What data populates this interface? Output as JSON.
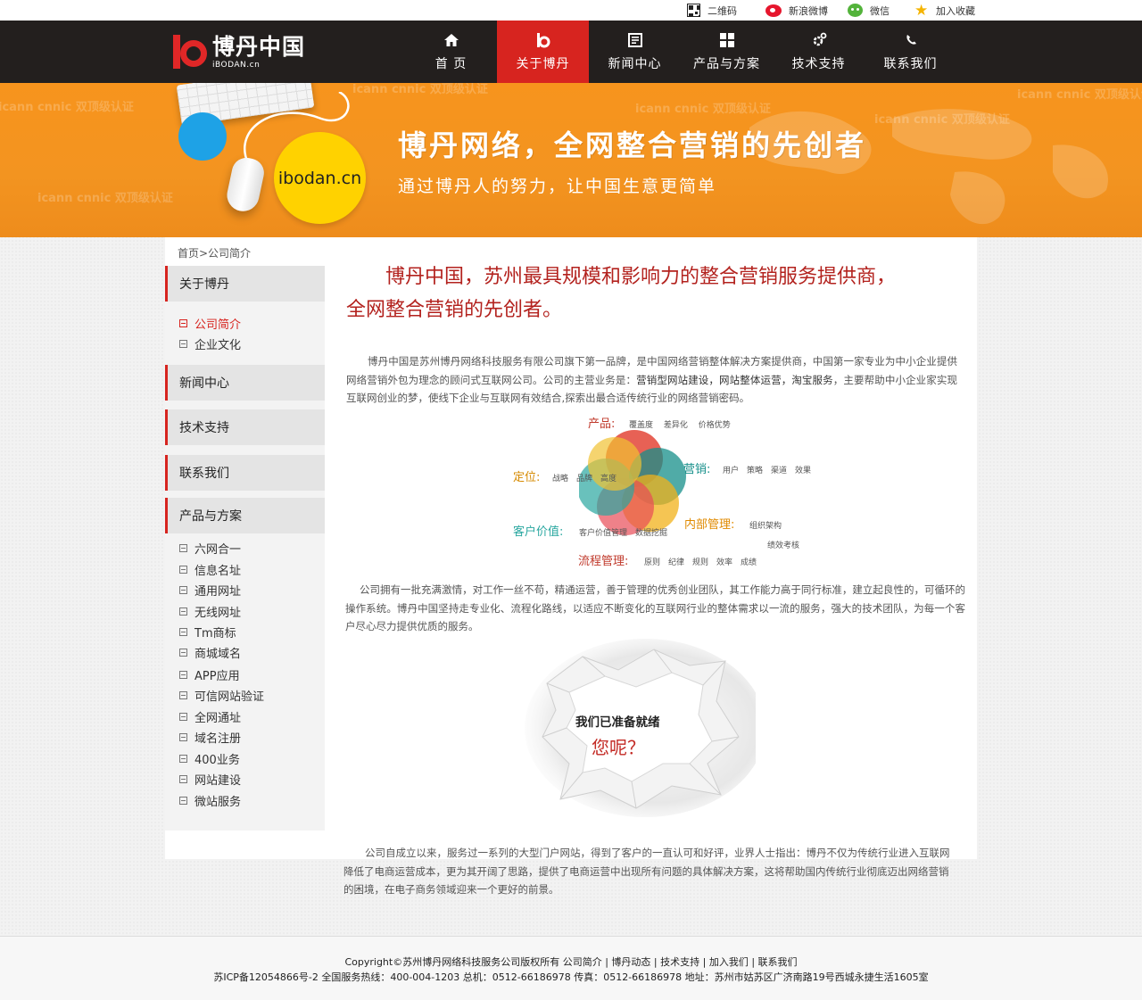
{
  "topbar": {
    "items": [
      {
        "label": "二维码",
        "icon": "qr-code-icon"
      },
      {
        "label": "新浪微博",
        "icon": "weibo-icon"
      },
      {
        "label": "微信",
        "icon": "wechat-icon"
      },
      {
        "label": "加入收藏",
        "icon": "star-icon"
      }
    ]
  },
  "header": {
    "logo_name": "博丹中国",
    "logo_sub": "iBODAN.cn",
    "nav": [
      {
        "label": "首 页",
        "icon": "home-icon"
      },
      {
        "label": "关于博丹",
        "icon": "logo-b-icon",
        "active": true
      },
      {
        "label": "新闻中心",
        "icon": "news-icon"
      },
      {
        "label": "产品与方案",
        "icon": "grid-icon"
      },
      {
        "label": "技术支持",
        "icon": "gear-icon"
      },
      {
        "label": "联系我们",
        "icon": "phone-icon"
      }
    ],
    "accent_color": "#d7241f"
  },
  "banner": {
    "title": "博丹网络，全网整合营销的先创者",
    "subtitle": "通过博丹人的努力，让中国生意更简单",
    "domain_badge": "ibodan.cn",
    "watermarks": [
      "icann cnnic 双顶级认证",
      "icann cnnic 双顶级认证",
      "icann cnnic 双顶级认证",
      "icann cnnic 双顶级认证",
      "icann cnnic 双顶级认证",
      "icann cnnic 双顶级认证"
    ],
    "color": "#f39420"
  },
  "breadcrumb": "首页>公司简介",
  "sidebar": {
    "about": "关于博丹",
    "about_items": [
      "公司简介",
      "企业文化"
    ],
    "news": "新闻中心",
    "tech": "技术支持",
    "contact": "联系我们",
    "products": "产品与方案",
    "product_items": [
      "六网合一",
      "信息名址",
      "通用网址",
      "无线网址",
      "Tm商标",
      "商城域名",
      "APP应用",
      "可信网站验证",
      "全网通址",
      "域名注册",
      "400业务",
      "网站建设",
      "微站服务"
    ]
  },
  "main": {
    "headline_1": "博丹中国，苏州最具规模和影响力的整合营销服务提供商，",
    "headline_2": "全网整合营销的先创者。",
    "intro_a": "博丹中国是苏州博丹网络科技服务有限公司旗下第一品牌，是中国网络营销整体解决方案提供商，中国第一家专业为中小企业提供网络营销外包为理念的顾问式互联网公司。公司的主营业务是：",
    "intro_b": "营销型网站建设，网站整体运营，淘宝服务",
    "intro_c": "，主要帮助中小企业家实现互联网创业的梦，使线下企业与互联网有效结合,探索出最合适传统行业的网络营销密码。",
    "venn": {
      "product": "产品:",
      "product_sub": "覆盖度　 差异化　 价格优势",
      "position": "定位:",
      "position_sub": "战略　品牌　高度",
      "marketing": "营销:",
      "marketing_sub": "用户　策略　渠道　效果",
      "customer": "客户价值:",
      "customer_sub": "客户价值管理　数据挖掘",
      "internal": "内部管理:",
      "internal_sub1": "组织架构",
      "internal_sub2": "绩效考核",
      "process": "流程管理:",
      "process_sub": "原则　纪律　规则　效率　成绩"
    },
    "team_para": "公司拥有一批充满激情，对工作一丝不苟，精通运营，善于管理的优秀创业团队，其工作能力高于同行标准，建立起良性的，可循环的操作系统。博丹中国坚持走专业化、流程化路线，以适应不断变化的互联网行业的整体需求以一流的服务，强大的技术团队，为每一个客户尽心尽力提供优质的服务。",
    "paper_line1": "我们已准备就绪",
    "paper_line2": "您呢？",
    "closing_para": "公司自成立以来，服务过一系列的大型门户网站，得到了客户的一直认可和好评，业界人士指出：博丹不仅为传统行业进入互联网降低了电商运营成本，更为其开阔了思路，提供了电商运营中出现所有问题的具体解决方案，这将帮助国内传统行业彻底迈出网络营销的困境，在电子商务领域迎来一个更好的前景。"
  },
  "footer": {
    "copyright": "Copyright©苏州博丹网络科技服务公司版权所有",
    "links": [
      "公司简介",
      "博丹动态",
      "技术支持",
      "加入我们",
      "联系我们"
    ],
    "info": "苏ICP备12054866号-2 全国服务热线：400-004-1203 总机：0512-66186978 传真：0512-66186978 地址：苏州市姑苏区广济南路19号西城永捷生活1605室"
  }
}
